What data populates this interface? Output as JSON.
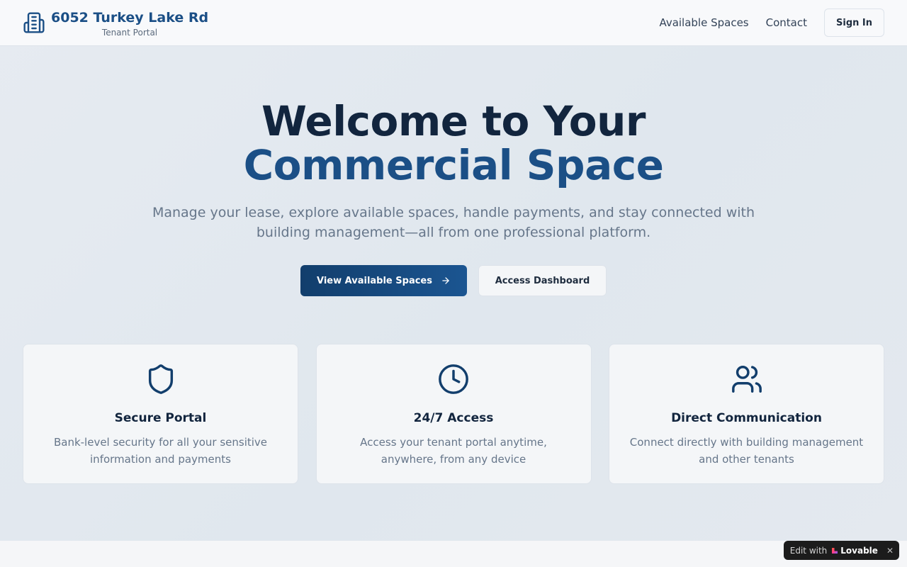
{
  "header": {
    "brand_icon": "building-icon",
    "brand_title": "6052 Turkey Lake Rd",
    "brand_subtitle": "Tenant Portal",
    "nav": {
      "available_spaces": "Available Spaces",
      "contact": "Contact",
      "sign_in": "Sign In"
    }
  },
  "hero": {
    "title_line1": "Welcome to Your",
    "title_line2": "Commercial Space",
    "description": "Manage your lease, explore available spaces, handle payments, and stay connected with building management—all from one professional platform.",
    "primary_button": "View Available Spaces",
    "primary_button_icon": "arrow-right-icon",
    "secondary_button": "Access Dashboard"
  },
  "features": [
    {
      "icon": "shield-icon",
      "title": "Secure Portal",
      "description": "Bank-level security for all your sensitive information and payments"
    },
    {
      "icon": "clock-icon",
      "title": "24/7 Access",
      "description": "Access your tenant portal anytime, anywhere, from any device"
    },
    {
      "icon": "users-icon",
      "title": "Direct Communication",
      "description": "Connect directly with building management and other tenants"
    }
  ],
  "badge": {
    "prefix": "Edit with",
    "brand": "Lovable",
    "close": "✕"
  },
  "colors": {
    "brand_blue": "#1b4f86",
    "dark_navy": "#12253e",
    "muted_text": "#66768a",
    "primary_gradient_start": "#123e6c",
    "primary_gradient_end": "#1b5591"
  }
}
